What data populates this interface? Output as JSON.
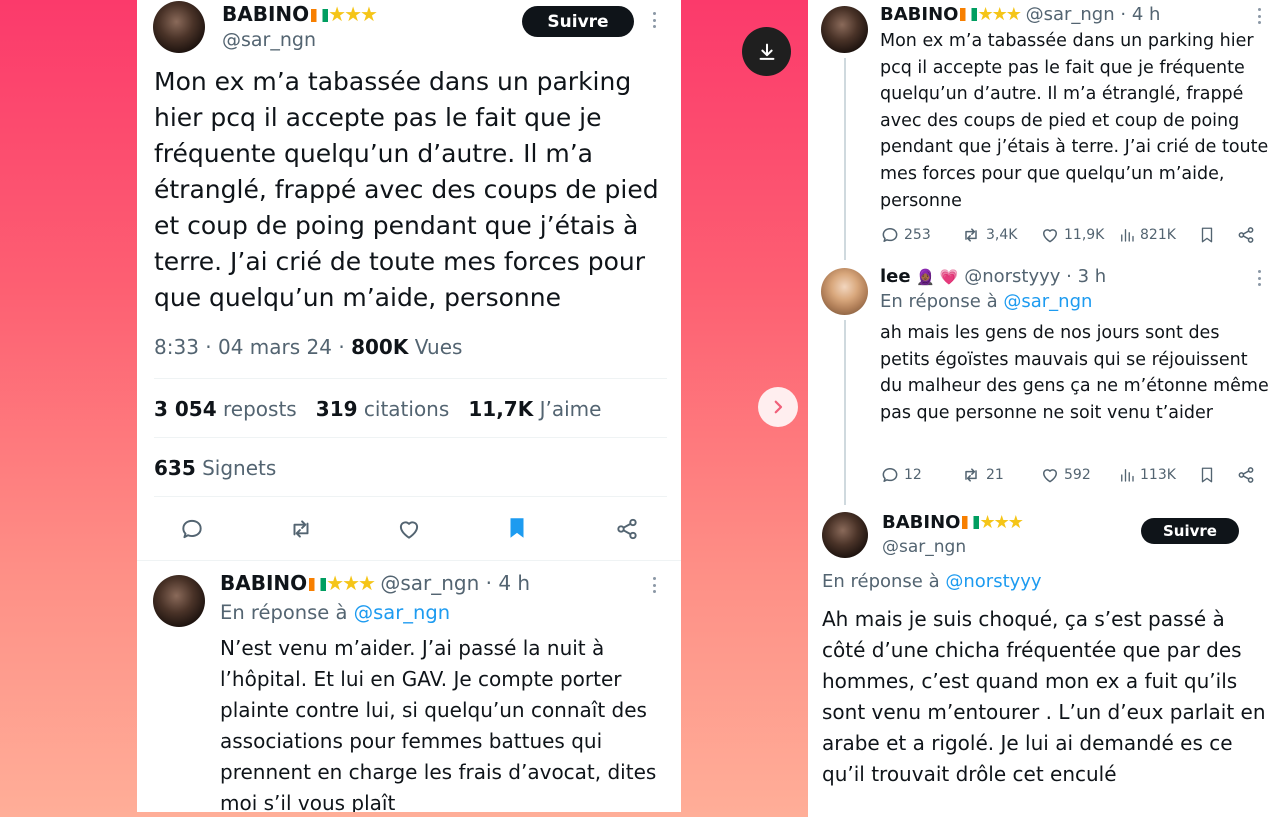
{
  "left": {
    "main": {
      "name": "BABINO",
      "stars": "★★★",
      "handle": "@sar_ngn",
      "follow_label": "Suivre",
      "text": "Mon ex m’a tabassée dans un parking hier pcq il accepte pas le fait que je fréquente quelqu’un d’autre. Il m’a étranglé, frappé avec des coups de pied et coup de poing pendant que j’étais à terre. J’ai crié de toute mes forces pour que quelqu’un m’aide, personne",
      "time": "8:33",
      "date": "04 mars 24",
      "views_count": "800K",
      "views_label": "Vues",
      "reposts_count": "3 054",
      "reposts_label": "reposts",
      "quotes_count": "319",
      "quotes_label": "citations",
      "likes_count": "11,7K",
      "likes_label": "J’aime",
      "bookmarks_count": "635",
      "bookmarks_label": "Signets"
    },
    "reply": {
      "name": "BABINO",
      "stars": "★★★",
      "handle": "@sar_ngn",
      "time": "4 h",
      "in_reply_prefix": "En réponse à",
      "in_reply_handle": "@sar_ngn",
      "text": "N’est venu m’aider. J’ai passé la nuit à l’hôpital. Et lui en GAV. Je compte porter plainte contre lui, si quelqu’un connaît des associations pour femmes battues qui prennent en charge les frais d’avocat, dites moi s’il vous plaît"
    }
  },
  "right": {
    "tweet1": {
      "name": "BABINO",
      "stars": "★★★",
      "handle": "@sar_ngn",
      "time": "4 h",
      "text": "Mon ex m’a tabassée dans un parking hier pcq il accepte pas le fait que je fréquente quelqu’un d’autre. Il m’a étranglé, frappé avec des coups de pied et coup de poing pendant que j’étais à terre. J’ai crié de toute mes forces pour que quelqu’un m’aide, personne",
      "replies": "253",
      "reposts": "3,4K",
      "likes": "11,9K",
      "views": "821K"
    },
    "tweet2": {
      "name": "lee",
      "emojis": "🧕🏾 💗",
      "handle": "@norstyyy",
      "time": "3 h",
      "in_reply_prefix": "En réponse à",
      "in_reply_handle": "@sar_ngn",
      "text": "ah mais les gens de nos jours sont des petits égoïstes mauvais qui se réjouissent du malheur des gens ça ne m’étonne même pas que personne ne soit venu t’aider",
      "replies": "12",
      "reposts": "21",
      "likes": "592",
      "views": "113K"
    },
    "tweet3": {
      "name": "BABINO",
      "stars": "★★★",
      "handle": "@sar_ngn",
      "follow_label": "Suivre",
      "in_reply_prefix": "En réponse à",
      "in_reply_handle": "@norstyyy",
      "text": "Ah mais je suis choqué, ça s’est passé à côté d’une chicha fréquentée que par des hommes, c’est quand mon ex a fuit qu’ils sont venu m’entourer . L’un d’eux parlait en arabe et a rigolé. Je lui ai demandé es ce qu’il trouvait drôle cet enculé"
    }
  },
  "icons": {
    "download": "download-icon",
    "next": "chevron-right-icon",
    "reply": "comment-icon",
    "repost": "repost-icon",
    "like": "heart-icon",
    "bookmark": "bookmark-icon",
    "share": "share-icon",
    "views": "views-icon",
    "more": "more-icon"
  },
  "colors": {
    "bookmark_active": "#1d9bf0",
    "link": "#1d9bf0",
    "follow_button": "#0f1419",
    "background_top": "#fb3a6b",
    "background_bottom": "#ffae98"
  }
}
